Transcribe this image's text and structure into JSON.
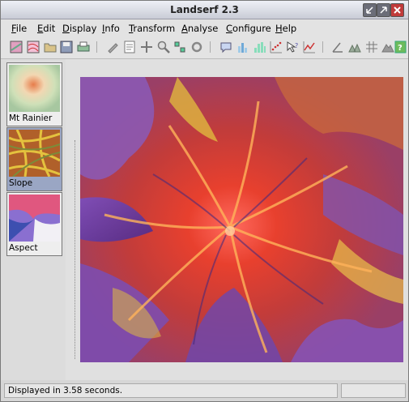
{
  "window": {
    "title": "Landserf 2.3"
  },
  "menu": {
    "items": [
      {
        "label": "File",
        "underline": "F"
      },
      {
        "label": "Edit",
        "underline": "E"
      },
      {
        "label": "Display",
        "underline": "D"
      },
      {
        "label": "Info",
        "underline": "I"
      },
      {
        "label": "Transform",
        "underline": "T"
      },
      {
        "label": "Analyse",
        "underline": "A"
      },
      {
        "label": "Configure",
        "underline": "C"
      },
      {
        "label": "Help",
        "underline": "H"
      }
    ]
  },
  "toolbar": {
    "icons": [
      "new-raster-icon",
      "new-vector-icon",
      "open-folder-icon",
      "save-icon",
      "print-icon",
      "edit-pencil-icon",
      "edit-text-icon",
      "cross-move-icon",
      "zoom-icon",
      "zoom-fit-icon",
      "rotate-icon",
      "comment-icon",
      "bar-chart-icon",
      "histogram-icon",
      "scatter-plot-icon",
      "query-icon",
      "line-graph-icon",
      "angle-icon",
      "triangles-icon",
      "grid-icon",
      "mountain-icon",
      "help-icon"
    ]
  },
  "thumbnails": [
    {
      "label": "Mt Rainier",
      "selected": false
    },
    {
      "label": "Slope",
      "selected": true
    },
    {
      "label": "Aspect",
      "selected": false
    }
  ],
  "status": {
    "message": "Displayed in 3.58 seconds.",
    "secondary": ""
  },
  "colors": {
    "titlebar": "#d8dbe4",
    "close": "#c03a3a",
    "selected": "#9aa6c4"
  }
}
